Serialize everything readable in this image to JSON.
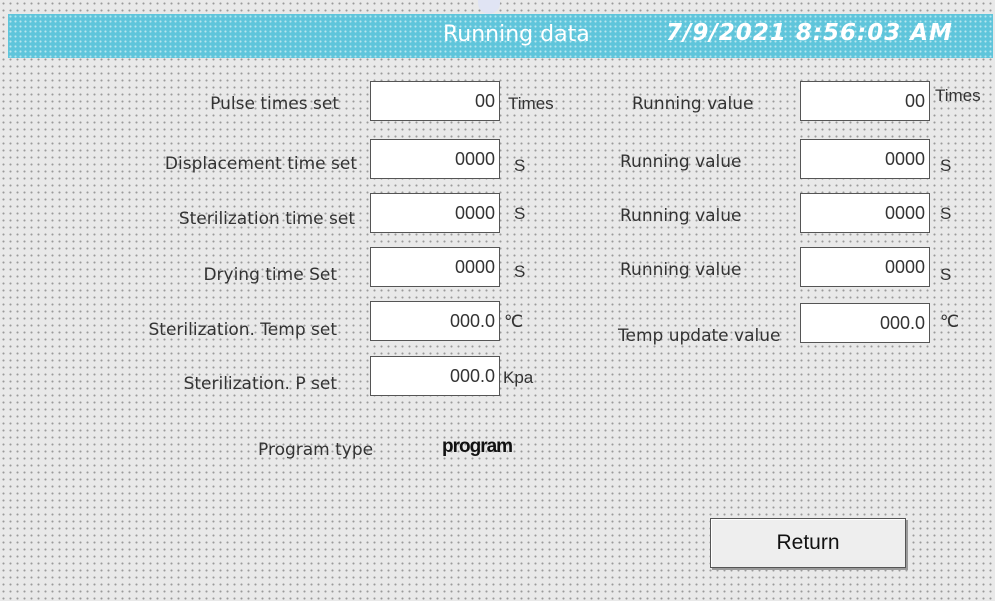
{
  "header": {
    "title": "Running data",
    "datetime": "7/9/2021 8:56:03 AM"
  },
  "settings": [
    {
      "label": "Pulse times set",
      "value": "00",
      "unit": "Times"
    },
    {
      "label": "Displacement time set",
      "value": "0000",
      "unit": "S"
    },
    {
      "label": "Sterilization time set",
      "value": "0000",
      "unit": "S"
    },
    {
      "label": "Drying time Set",
      "value": "0000",
      "unit": "S"
    },
    {
      "label": "Sterilization. Temp set",
      "value": "000.0",
      "unit": "℃"
    },
    {
      "label": "Sterilization. P set",
      "value": "000.0",
      "unit": "Kpa"
    }
  ],
  "running": [
    {
      "label": "Running value",
      "value": "00",
      "unit": "Times"
    },
    {
      "label": "Running value",
      "value": "0000",
      "unit": "S"
    },
    {
      "label": "Running value",
      "value": "0000",
      "unit": "S"
    },
    {
      "label": "Running value",
      "value": "0000",
      "unit": "S"
    },
    {
      "label": "Temp update value",
      "value": "000.0",
      "unit": "℃"
    }
  ],
  "program": {
    "label": "Program type",
    "value": "program"
  },
  "buttons": {
    "return_label": "Return"
  },
  "colors": {
    "header_bg": "#5fc5db",
    "screen_bg": "#e9e9e9"
  }
}
